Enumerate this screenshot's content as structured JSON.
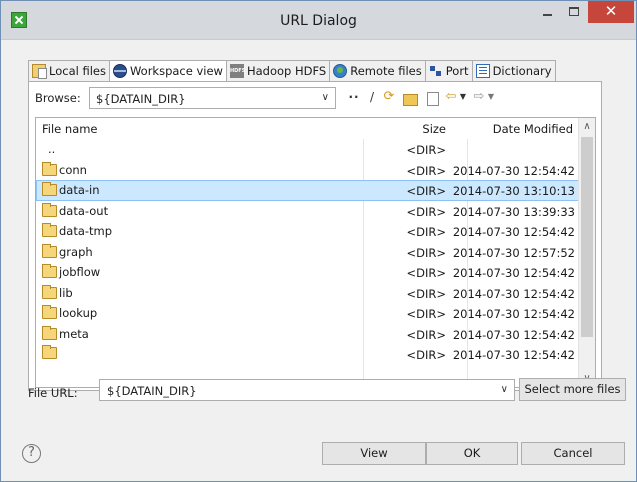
{
  "window": {
    "title": "URL Dialog",
    "minimize": "–",
    "maximize": "□",
    "close": "✕"
  },
  "tabs": [
    {
      "label": "Local files",
      "icon": "local-files-icon"
    },
    {
      "label": "Workspace view",
      "icon": "workspace-icon"
    },
    {
      "label": "Hadoop HDFS",
      "icon": "hdfs-icon",
      "icon_text": "HDFS"
    },
    {
      "label": "Remote files",
      "icon": "remote-files-icon"
    },
    {
      "label": "Port",
      "icon": "port-icon"
    },
    {
      "label": "Dictionary",
      "icon": "dictionary-icon"
    }
  ],
  "browse": {
    "label": "Browse:",
    "value": "${DATAIN_DIR}",
    "toolbar": {
      "up": "··",
      "root": "/",
      "refresh": "⟳",
      "back": "⇦",
      "back_menu": "▼",
      "forward": "⇨",
      "forward_menu": "▼"
    }
  },
  "table": {
    "columns": {
      "name": "File name",
      "size": "Size",
      "date": "Date Modified"
    },
    "rows": [
      {
        "name": "..",
        "size": "<DIR>",
        "date": "",
        "folder": false,
        "selected": false
      },
      {
        "name": "conn",
        "size": "<DIR>",
        "date": "2014-07-30 12:54:42",
        "folder": true,
        "selected": false
      },
      {
        "name": "data-in",
        "size": "<DIR>",
        "date": "2014-07-30 13:10:13",
        "folder": true,
        "selected": true
      },
      {
        "name": "data-out",
        "size": "<DIR>",
        "date": "2014-07-30 13:39:33",
        "folder": true,
        "selected": false
      },
      {
        "name": "data-tmp",
        "size": "<DIR>",
        "date": "2014-07-30 12:54:42",
        "folder": true,
        "selected": false
      },
      {
        "name": "graph",
        "size": "<DIR>",
        "date": "2014-07-30 12:57:52",
        "folder": true,
        "selected": false
      },
      {
        "name": "jobflow",
        "size": "<DIR>",
        "date": "2014-07-30 12:54:42",
        "folder": true,
        "selected": false
      },
      {
        "name": "lib",
        "size": "<DIR>",
        "date": "2014-07-30 12:54:42",
        "folder": true,
        "selected": false
      },
      {
        "name": "lookup",
        "size": "<DIR>",
        "date": "2014-07-30 12:54:42",
        "folder": true,
        "selected": false
      },
      {
        "name": "meta",
        "size": "<DIR>",
        "date": "2014-07-30 12:54:42",
        "folder": true,
        "selected": false
      },
      {
        "name": "",
        "size": "<DIR>",
        "date": "2014-07-30 12:54:42",
        "folder": true,
        "selected": false
      }
    ]
  },
  "file_url": {
    "label": "File URL:",
    "value": "${DATAIN_DIR}",
    "select_more": "Select more files"
  },
  "footer": {
    "help": "?",
    "view": "View",
    "ok": "OK",
    "cancel": "Cancel"
  },
  "colors": {
    "selection": "#cce8ff",
    "close_button": "#c7463c",
    "titlebar": "#d5d9de"
  }
}
